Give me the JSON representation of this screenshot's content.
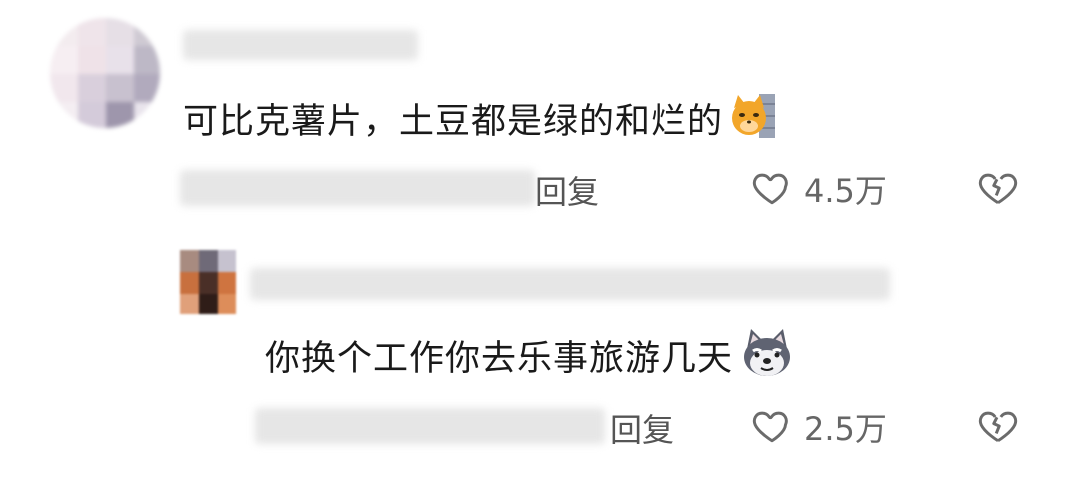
{
  "comments": [
    {
      "text": "可比克薯片，土豆都是绿的和烂的",
      "emoji": "cat-face-emoji",
      "reply_label": "回复",
      "like_count": "4.5万"
    },
    {
      "text": "你换个工作你去乐事旅游几天",
      "emoji": "dog-face-emoji",
      "reply_label": "回复",
      "like_count": "2.5万"
    }
  ],
  "colors": {
    "text": "#1a1a1a",
    "meta": "#555555",
    "icon": "#6b6b6b"
  }
}
